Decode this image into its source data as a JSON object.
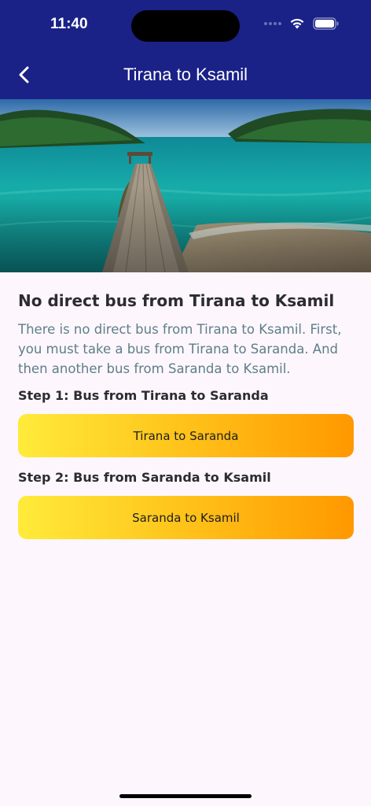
{
  "status_bar": {
    "time": "11:40",
    "icons": [
      "signal-icon",
      "wifi-icon",
      "battery-icon"
    ]
  },
  "nav": {
    "title": "Tirana to Ksamil",
    "back_icon": "chevron-left-icon"
  },
  "hero": {
    "image": "beach-pier-photo"
  },
  "content": {
    "heading": "No direct bus from Tirana to Ksamil",
    "description": "There is no direct bus from Tirana to Ksamil. First, you must take a bus from Tirana to Saranda. And then another bus from Saranda to Ksamil.",
    "steps": [
      {
        "label": "Step 1: Bus from Tirana to Saranda",
        "button": "Tirana to Saranda"
      },
      {
        "label": "Step 2: Bus from Saranda to Ksamil",
        "button": "Saranda to Ksamil"
      }
    ]
  },
  "colors": {
    "header": "#1a2187",
    "background": "#fdf6fc",
    "button_start": "#ffeb3b",
    "button_end": "#ff9800",
    "description_text": "#5d7f89"
  }
}
